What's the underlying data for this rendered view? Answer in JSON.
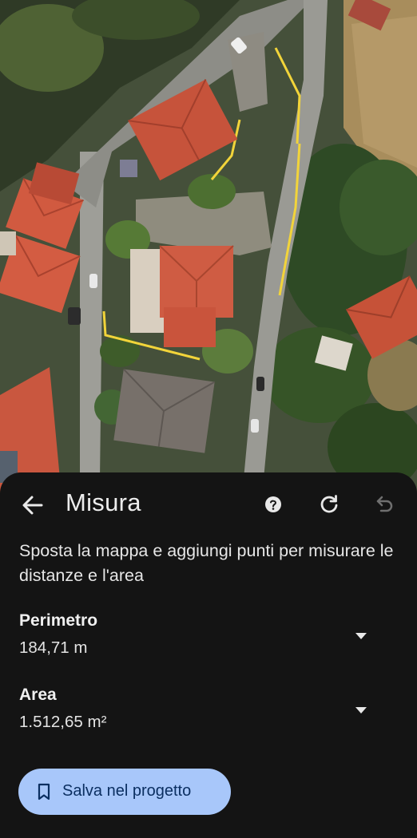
{
  "header": {
    "title": "Misura"
  },
  "instructions": "Sposta la mappa e aggiungi punti per misurare le distanze e l'area",
  "measurements": [
    {
      "label": "Perimetro",
      "value": "184,71 m"
    },
    {
      "label": "Area",
      "value": "1.512,65 m²"
    }
  ],
  "actions": {
    "save_label": "Salva nel progetto"
  },
  "icons": {
    "back": "arrow-left-icon",
    "help": "help-icon",
    "reset": "refresh-icon",
    "undo": "undo-icon",
    "expand": "caret-down-icon",
    "save": "bookmark-icon"
  },
  "colors": {
    "sheet_background": "#141414",
    "accent_button": "#a8c7fa",
    "measure_line": "#f2d43a"
  }
}
